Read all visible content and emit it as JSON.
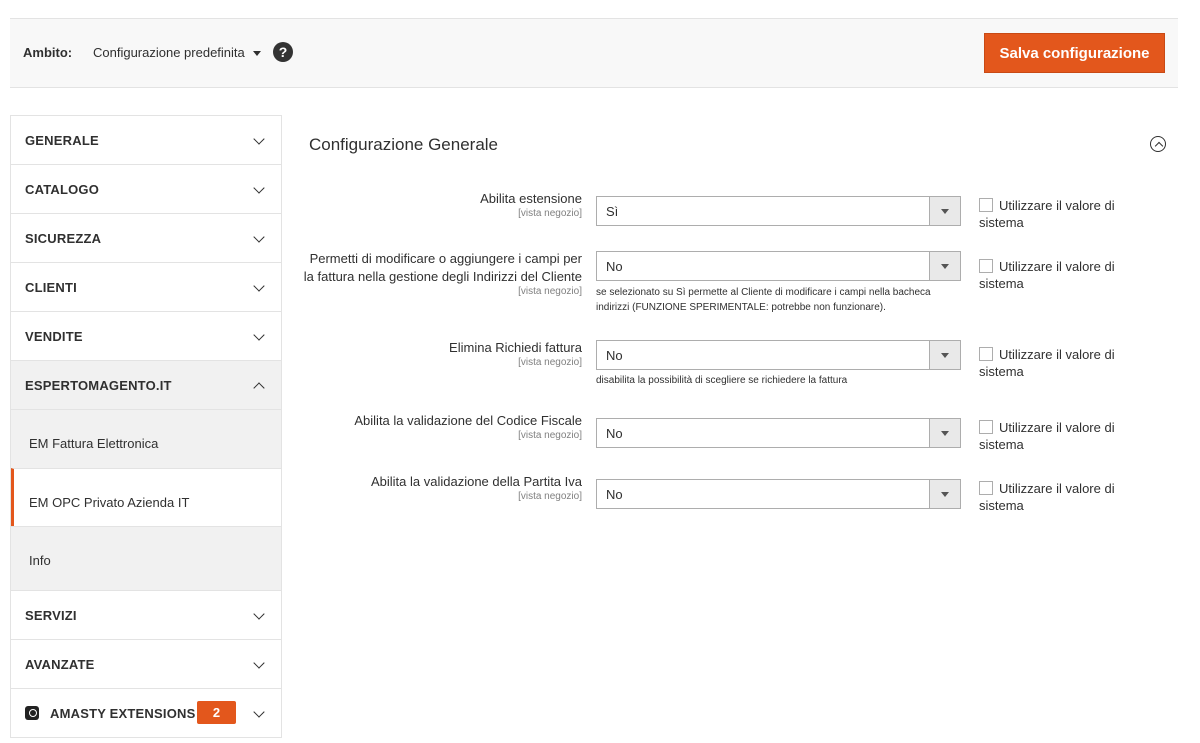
{
  "toolbar": {
    "scope_label": "Ambito:",
    "scope_value": "Configurazione predefinita",
    "help_icon": "?",
    "save_label": "Salva configurazione"
  },
  "sidebar": {
    "items": [
      {
        "label": "GENERALE"
      },
      {
        "label": "CATALOGO"
      },
      {
        "label": "SICUREZZA"
      },
      {
        "label": "CLIENTI"
      },
      {
        "label": "VENDITE"
      },
      {
        "label": "ESPERTOMAGENTO.IT"
      }
    ],
    "subitems": [
      {
        "label": "EM Fattura Elettronica"
      },
      {
        "label": "EM OPC Privato Azienda IT"
      },
      {
        "label": "Info"
      }
    ],
    "after": [
      {
        "label": "SERVIZI"
      },
      {
        "label": "AVANZATE"
      },
      {
        "label": "AMASTY EXTENSIONS",
        "badge": "2"
      }
    ]
  },
  "main": {
    "section_title": "Configurazione Generale",
    "scope_tag": "[vista negozio]",
    "use_system": "Utilizzare il valore di sistema",
    "fields": [
      {
        "label": "Abilita estensione",
        "value": "Sì"
      },
      {
        "label": "Permetti di modificare o aggiungere i campi per la fattura nella gestione degli Indirizzi del Cliente",
        "value": "No",
        "note": "se selezionato su Sì permette al Cliente di modificare i campi nella bacheca indirizzi (FUNZIONE SPERIMENTALE: potrebbe non funzionare)."
      },
      {
        "label": "Elimina Richiedi fattura",
        "value": "No",
        "note": "disabilita la possibilità di scegliere se richiedere la fattura"
      },
      {
        "label": "Abilita la validazione del Codice Fiscale",
        "value": "No"
      },
      {
        "label": "Abilita la validazione della Partita Iva",
        "value": "No"
      }
    ]
  }
}
